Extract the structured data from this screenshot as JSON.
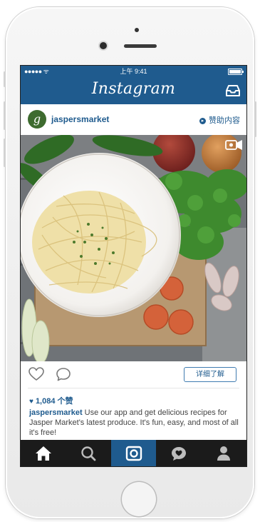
{
  "status_bar": {
    "signal": "●●●●● ᯤ",
    "time": "上午 9:41",
    "battery_level": 1.0
  },
  "app": {
    "name": "Instagram"
  },
  "post": {
    "username": "jaspersmarket",
    "avatar_letter": "g",
    "sponsored_label": "赞助内容",
    "learn_more_label": "详细了解",
    "likes_text": "1,084 个赞",
    "caption_user": "jaspersmarket",
    "caption_text": " Use our app and get delicious recipes for Jasper Market's latest produce. It's fun, easy, and most of all it's free!"
  },
  "tabs": [
    {
      "icon": "home-icon"
    },
    {
      "icon": "search-icon"
    },
    {
      "icon": "camera-icon",
      "active": true
    },
    {
      "icon": "activity-heart-icon"
    },
    {
      "icon": "profile-icon"
    }
  ],
  "colors": {
    "brand": "#1f5b8e",
    "tabbar": "#1b1b1b",
    "text": "#444444"
  }
}
